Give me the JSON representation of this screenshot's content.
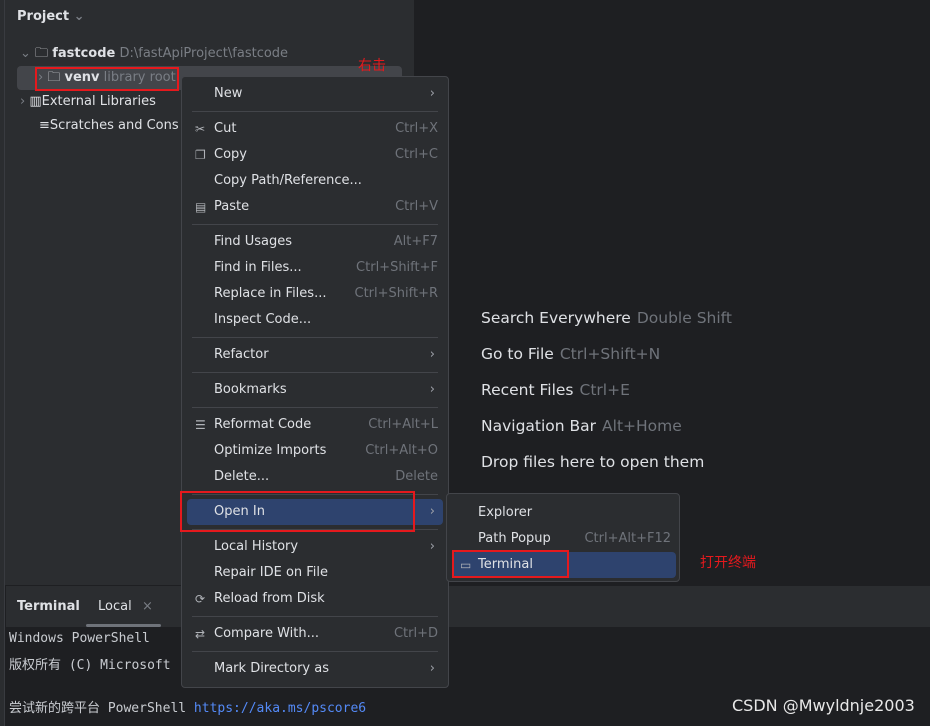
{
  "project": {
    "title": "Project",
    "root_name": "fastcode",
    "root_path": "D:\\fastApiProject\\fastcode",
    "venv_name": "venv",
    "venv_hint": "library root",
    "ext_libs": "External Libraries",
    "scratches": "Scratches and Cons"
  },
  "menu": {
    "items": [
      {
        "label": "New",
        "submenu": true
      },
      {
        "label": "Cut",
        "shortcut": "Ctrl+X",
        "icon": "scissors-icon"
      },
      {
        "label": "Copy",
        "shortcut": "Ctrl+C",
        "icon": "copy-icon"
      },
      {
        "label": "Copy Path/Reference..."
      },
      {
        "label": "Paste",
        "shortcut": "Ctrl+V",
        "icon": "paste-icon"
      },
      {
        "label": "Find Usages",
        "shortcut": "Alt+F7"
      },
      {
        "label": "Find in Files...",
        "shortcut": "Ctrl+Shift+F"
      },
      {
        "label": "Replace in Files...",
        "shortcut": "Ctrl+Shift+R"
      },
      {
        "label": "Inspect Code..."
      },
      {
        "label": "Refactor",
        "submenu": true
      },
      {
        "label": "Bookmarks",
        "submenu": true
      },
      {
        "label": "Reformat Code",
        "shortcut": "Ctrl+Alt+L",
        "icon": "reformat-icon"
      },
      {
        "label": "Optimize Imports",
        "shortcut": "Ctrl+Alt+O"
      },
      {
        "label": "Delete...",
        "shortcut": "Delete"
      },
      {
        "label": "Open In",
        "submenu": true,
        "selected": true
      },
      {
        "label": "Local History",
        "submenu": true
      },
      {
        "label": "Repair IDE on File"
      },
      {
        "label": "Reload from Disk",
        "icon": "reload-icon"
      },
      {
        "label": "Compare With...",
        "shortcut": "Ctrl+D",
        "icon": "compare-icon"
      },
      {
        "label": "Mark Directory as",
        "submenu": true
      }
    ]
  },
  "submenu": {
    "items": [
      {
        "label": "Explorer"
      },
      {
        "label": "Path Popup",
        "shortcut": "Ctrl+Alt+F12"
      },
      {
        "label": "Terminal",
        "selected": true,
        "icon": "terminal-icon"
      }
    ]
  },
  "welcome": [
    {
      "label": "Search Everywhere",
      "key": "Double Shift"
    },
    {
      "label": "Go to File",
      "key": "Ctrl+Shift+N"
    },
    {
      "label": "Recent Files",
      "key": "Ctrl+E"
    },
    {
      "label": "Navigation Bar",
      "key": "Alt+Home"
    },
    {
      "label": "Drop files here to open them",
      "key": ""
    }
  ],
  "terminal": {
    "title": "Terminal",
    "tab": "Local",
    "lines": [
      "Windows PowerShell",
      "版权所有 (C) Microsoft"
    ],
    "line3_prefix": "尝试新的跨平台 PowerShell ",
    "link": "https://aka.ms/pscore6"
  },
  "annotations": {
    "right_click": "右击",
    "open_terminal": "打开终端"
  },
  "watermark": "CSDN @Mwyldnje2003",
  "colors": {
    "selection": "#2e436e",
    "annotation": "#e5191d",
    "link": "#548af7"
  }
}
